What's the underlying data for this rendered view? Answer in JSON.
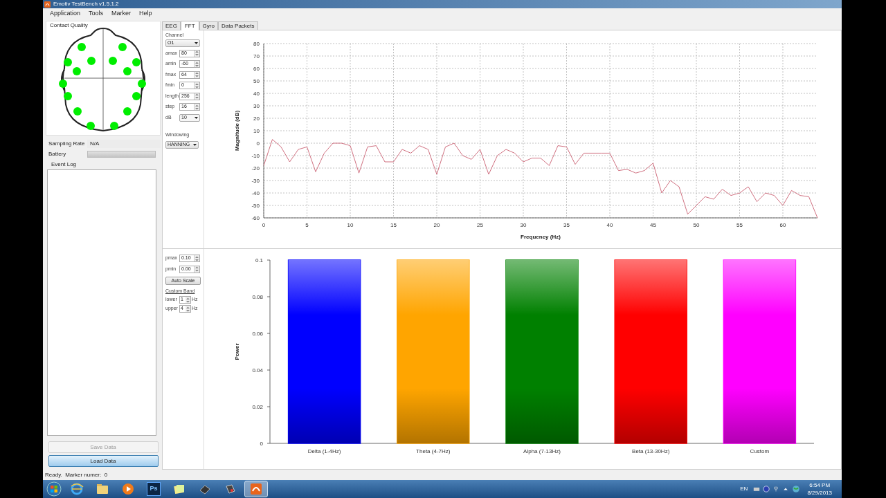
{
  "window": {
    "title": "Emotiv TestBench v1.5.1.2"
  },
  "menu": [
    "Application",
    "Tools",
    "Marker",
    "Help"
  ],
  "contact_quality": {
    "title": "Contact Quality",
    "sensors": [
      {
        "color": "#00ee00"
      },
      {
        "color": "#00ee00"
      },
      {
        "color": "#00ee00"
      },
      {
        "color": "#00ee00"
      },
      {
        "color": "#00ee00"
      },
      {
        "color": "#00ee00"
      },
      {
        "color": "#00ee00"
      },
      {
        "color": "#00ee00"
      },
      {
        "color": "#00ee00"
      },
      {
        "color": "#00ee00"
      },
      {
        "color": "#00ee00"
      },
      {
        "color": "#00ee00"
      },
      {
        "color": "#00ee00"
      },
      {
        "color": "#00ee00"
      },
      {
        "color": "#00ee00"
      },
      {
        "color": "#00ee00"
      }
    ]
  },
  "sampling_rate": {
    "label": "Sampling Rate",
    "value": "N/A"
  },
  "battery": {
    "label": "Battery",
    "level": 0
  },
  "event_log": {
    "title": "Event Log"
  },
  "buttons": [
    {
      "label": "Save Data",
      "disabled": true
    },
    {
      "label": "Load Data",
      "disabled": false
    }
  ],
  "tabs": [
    {
      "label": "EEG",
      "selected": false
    },
    {
      "label": "FFT",
      "selected": true
    },
    {
      "label": "Gyro",
      "selected": false
    },
    {
      "label": "Data Packets",
      "selected": false
    }
  ],
  "fft_controls": {
    "channel_label": "Channel",
    "channel": "O1",
    "fields": [
      {
        "kind": "spin",
        "label": "amax",
        "value": "80"
      },
      {
        "kind": "spin",
        "label": "amin",
        "value": "-60"
      },
      {
        "kind": "spin",
        "label": "fmax",
        "value": "64"
      },
      {
        "kind": "spin",
        "label": "fmin",
        "value": "0"
      },
      {
        "kind": "spin",
        "label": "length",
        "value": "256"
      },
      {
        "kind": "spin",
        "label": "step",
        "value": "16"
      },
      {
        "kind": "dropdown",
        "label": "dB",
        "value": "10"
      }
    ],
    "windowing_label": "Windowing",
    "windowing": "HANNING"
  },
  "fft_chart": {
    "chart_data": {
      "type": "line",
      "xlabel": "Frequency (Hz)",
      "ylabel": "Magnitude (dB)",
      "xlim": [
        0,
        64
      ],
      "ylim": [
        -60,
        80
      ],
      "xticks": [
        0,
        5,
        10,
        15,
        20,
        25,
        30,
        35,
        40,
        45,
        50,
        55,
        60
      ],
      "yticks": [
        -60,
        -50,
        -40,
        -30,
        -20,
        -10,
        0,
        10,
        20,
        30,
        40,
        50,
        60,
        70,
        80
      ],
      "x": [
        0,
        1,
        2,
        3,
        4,
        5,
        6,
        7,
        8,
        9,
        10,
        11,
        12,
        13,
        14,
        15,
        16,
        17,
        18,
        19,
        20,
        21,
        22,
        23,
        24,
        25,
        26,
        27,
        28,
        29,
        30,
        31,
        32,
        33,
        34,
        35,
        36,
        37,
        38,
        39,
        40,
        41,
        42,
        43,
        44,
        45,
        46,
        47,
        48,
        49,
        50,
        51,
        52,
        53,
        54,
        55,
        56,
        57,
        58,
        59,
        60,
        61,
        62,
        63,
        64
      ],
      "grid": true,
      "series": [
        {
          "color": "#d07080",
          "values": [
            -18,
            3,
            -3,
            -15,
            -5,
            -3,
            -23,
            -8,
            0,
            0,
            -2,
            -24,
            -3,
            -2,
            -15,
            -15,
            -5,
            -8,
            -2,
            -5,
            -25,
            -3,
            0,
            -10,
            -13,
            -5,
            -25,
            -10,
            -5,
            -8,
            -15,
            -12,
            -12,
            -18,
            -2,
            -3,
            -17,
            -8,
            -8,
            -8,
            -8,
            -22,
            -21,
            -24,
            -22,
            -16,
            -40,
            -30,
            -35,
            -57,
            -50,
            -43,
            -45,
            -37,
            -42,
            -40,
            -35,
            -47,
            -40,
            -42,
            -50,
            -38,
            -42,
            -43,
            -60
          ]
        }
      ]
    }
  },
  "power_controls": {
    "fields": [
      {
        "label": "pmax",
        "value": "0.10"
      },
      {
        "label": "pmin",
        "value": "0.00"
      }
    ],
    "auto_scale": "Auto Scale",
    "custom_band_label": "Custom Band",
    "band": [
      {
        "label": "lower",
        "value": "1",
        "unit": "Hz"
      },
      {
        "label": "upper",
        "value": "4",
        "unit": "Hz"
      }
    ]
  },
  "power_chart": {
    "chart_data": {
      "type": "bar",
      "ylabel": "Power",
      "ylim": [
        0,
        0.1
      ],
      "yticks": [
        {
          "value": 0,
          "label": "0"
        },
        {
          "value": 0.02,
          "label": "0.02"
        },
        {
          "value": 0.04,
          "label": "0.04"
        },
        {
          "value": 0.06,
          "label": "0.06"
        },
        {
          "value": 0.08,
          "label": "0.08"
        },
        {
          "value": 0.1,
          "label": "0.1"
        }
      ],
      "categories": [
        "Delta (1-4Hz)",
        "Theta (4-7Hz)",
        "Alpha (7-13Hz)",
        "Beta (13-30Hz)",
        "Custom"
      ],
      "series": [
        {
          "values": [
            0.1,
            0.1,
            0.1,
            0.1,
            0.1
          ]
        }
      ],
      "colors": [
        "#0000ff",
        "#ffa500",
        "#008000",
        "#ff0000",
        "#ff00ff"
      ]
    }
  },
  "status_bar": {
    "text": "Ready.  Marker numer:  0"
  },
  "taskbar": {
    "ps_label": "Ps",
    "language": "EN",
    "time": "6:54 PM",
    "date": "8/29/2013"
  }
}
